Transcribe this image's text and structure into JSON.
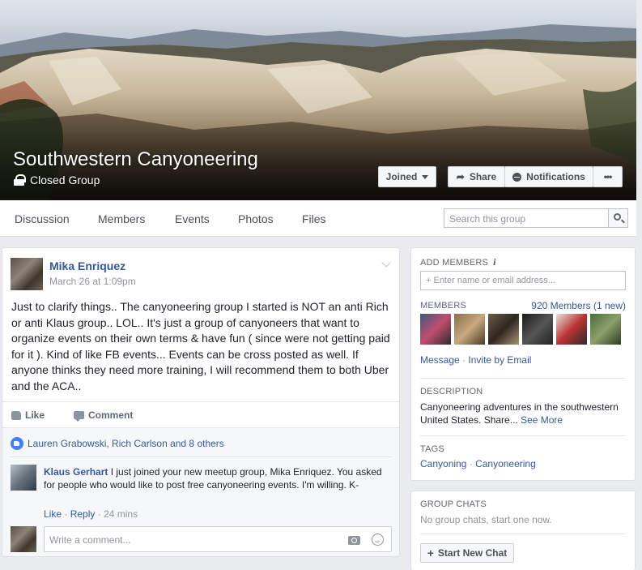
{
  "group": {
    "name": "Southwestern Canyoneering",
    "privacy": "Closed Group"
  },
  "cover_buttons": {
    "joined": "Joined",
    "share": "Share",
    "notifications": "Notifications",
    "more": "•••"
  },
  "tabs": [
    "Discussion",
    "Members",
    "Events",
    "Photos",
    "Files"
  ],
  "search": {
    "placeholder": "Search this group"
  },
  "post": {
    "author": "Mika Enriquez",
    "timestamp": "March 26 at 1:09pm",
    "text": "Just to clarify things.. The canyoneering group I started is NOT an anti Rich or anti Klaus group.. LOL.. It's just a group of canyoneers that want to organize events on their own terms & have fun ( since were not getting paid for it ). Kind of like FB events... Events can be cross posted as well. If anyone thinks they need more training, I will recommend them to both Uber and the ACA..",
    "like_label": "Like",
    "comment_label": "Comment",
    "likes_summary": "Lauren Grabowski, Rich Carlson and 8 others",
    "comment": {
      "author": "Klaus Gerhart",
      "text": "I just joined your new meetup group, Mika Enriquez. You asked for people who would like to post free canyoneering events. I'm willing. K-",
      "like": "Like",
      "reply": "Reply",
      "time": "24 mins"
    },
    "reply_placeholder": "Write a comment..."
  },
  "sidebar": {
    "add_members_heading": "ADD MEMBERS",
    "add_members_placeholder": "+ Enter name or email address...",
    "members_heading": "MEMBERS",
    "members_count": "920 Members (1 new)",
    "message_link": "Message",
    "invite_link": "Invite by Email",
    "description_heading": "DESCRIPTION",
    "description": "Canyoneering adventures in the southwestern United States. Share...",
    "see_more": "See More",
    "tags_heading": "TAGS",
    "tags": [
      "Canyoning",
      "Canyoneering"
    ],
    "group_chats_heading": "GROUP CHATS",
    "no_chats": "No group chats, start one now.",
    "start_chat": "Start New Chat"
  },
  "colors": {
    "link": "#365899",
    "background": "#e9ebee",
    "like_badge": "#4080ff"
  }
}
